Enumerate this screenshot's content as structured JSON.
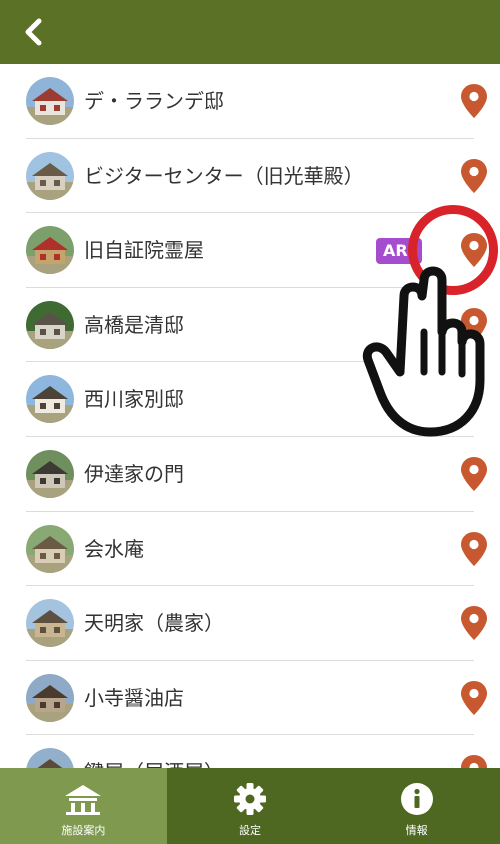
{
  "header": {
    "back_icon": "chevron-left-icon"
  },
  "facilities": [
    {
      "name": "デ・ラランデ邸",
      "has_pin": true,
      "has_ar": false
    },
    {
      "name": "ビジターセンター（旧光華殿）",
      "has_pin": true,
      "has_ar": false
    },
    {
      "name": "旧自証院霊屋",
      "has_pin": true,
      "has_ar": true,
      "ar_label": "AR"
    },
    {
      "name": "高橋是清邸",
      "has_pin": true,
      "has_ar": false
    },
    {
      "name": "西川家別邸",
      "has_pin": false,
      "has_ar": false
    },
    {
      "name": "伊達家の門",
      "has_pin": true,
      "has_ar": false
    },
    {
      "name": "会水庵",
      "has_pin": true,
      "has_ar": false
    },
    {
      "name": "天明家（農家）",
      "has_pin": true,
      "has_ar": false
    },
    {
      "name": "小寺醤油店",
      "has_pin": true,
      "has_ar": false
    },
    {
      "name": "鍵屋（居酒屋）",
      "has_pin": true,
      "has_ar": false
    }
  ],
  "tabs": [
    {
      "label": "施設案内",
      "icon": "building-icon",
      "active": true
    },
    {
      "label": "設定",
      "icon": "gear-icon",
      "active": false
    },
    {
      "label": "情報",
      "icon": "info-icon",
      "active": false
    }
  ],
  "colors": {
    "header": "#5a7126",
    "tab_bar": "#4e6822",
    "tab_active": "#7f9a4e",
    "pin": "#c8582f",
    "ar_badge": "#a64ccf",
    "highlight_ring": "#d8232a"
  }
}
